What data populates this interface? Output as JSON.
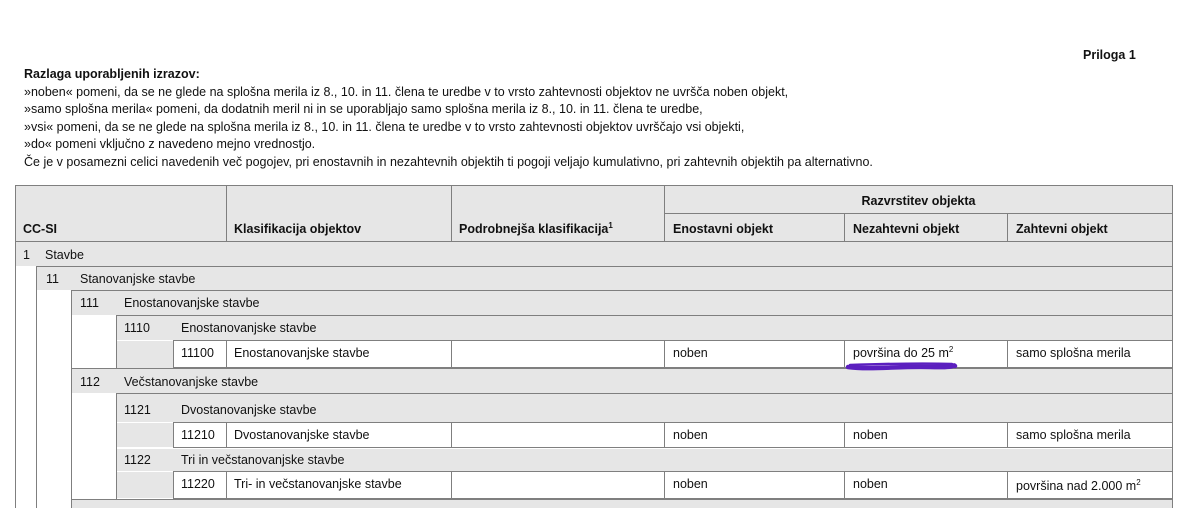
{
  "annex": "Priloga 1",
  "intro": {
    "heading": "Razlaga uporabljenih izrazov:",
    "lines": [
      "»noben« pomeni, da se ne glede na splošna merila iz 8., 10. in 11. člena te uredbe v to vrsto zahtevnosti objektov  ne uvršča noben objekt,",
      "»samo splošna merila« pomeni, da dodatnih meril ni in se uporabljajo samo splošna merila iz 8., 10. in 11. člena te uredbe,",
      "»vsi« pomeni, da se ne glede na splošna merila iz 8., 10. in 11. člena te uredbe v to vrsto zahtevnosti objektov  uvrščajo vsi objekti,",
      "»do« pomeni vključno z navedeno mejno vrednostjo.",
      "Če je v posamezni celici navedenih več pogojev, pri enostavnih in nezahtevnih objektih ti pogoji veljajo kumulativno, pri zahtevnih objektih pa alternativno."
    ]
  },
  "table": {
    "headers": {
      "cc_si": "CC-SI",
      "classification": "Klasifikacija objektov",
      "detailed": "Podrobnejša klasifikacija",
      "detailed_sup": "1",
      "group": "Razvrstitev objekta",
      "simple": "Enostavni objekt",
      "nondemanding": "Nezahtevni objekt",
      "demanding": "Zahtevni objekt"
    },
    "rows": {
      "r1": {
        "code": "1",
        "label": "Stavbe"
      },
      "r11": {
        "code": "11",
        "label": "Stanovanjske stavbe"
      },
      "r111": {
        "code": "111",
        "label": "Enostanovanjske stavbe"
      },
      "r1110": {
        "code": "1110",
        "label": "Enostanovanjske stavbe"
      },
      "r11100": {
        "code": "11100",
        "label": "Enostanovanjske stavbe",
        "detailed": "",
        "simple": "noben",
        "nondemanding": "površina do 25 m",
        "nondemanding_sup": "2",
        "demanding": "samo splošna merila"
      },
      "r112": {
        "code": "112",
        "label": "Večstanovanjske stavbe"
      },
      "r1121": {
        "code": "1121",
        "label": "Dvostanovanjske stavbe"
      },
      "r11210": {
        "code": "11210",
        "label": "Dvostanovanjske stavbe",
        "detailed": "",
        "simple": "noben",
        "nondemanding": "noben",
        "demanding": "samo splošna merila"
      },
      "r1122": {
        "code": "1122",
        "label": "Tri in večstanovanjske stavbe"
      },
      "r11220": {
        "code": "11220",
        "label": "Tri- in večstanovanjske stavbe",
        "detailed": "",
        "simple": "noben",
        "nondemanding": "noben",
        "demanding": "površina nad 2.000 m",
        "demanding_sup": "2"
      }
    }
  },
  "annotation": {
    "color": "#5b1fbf"
  }
}
